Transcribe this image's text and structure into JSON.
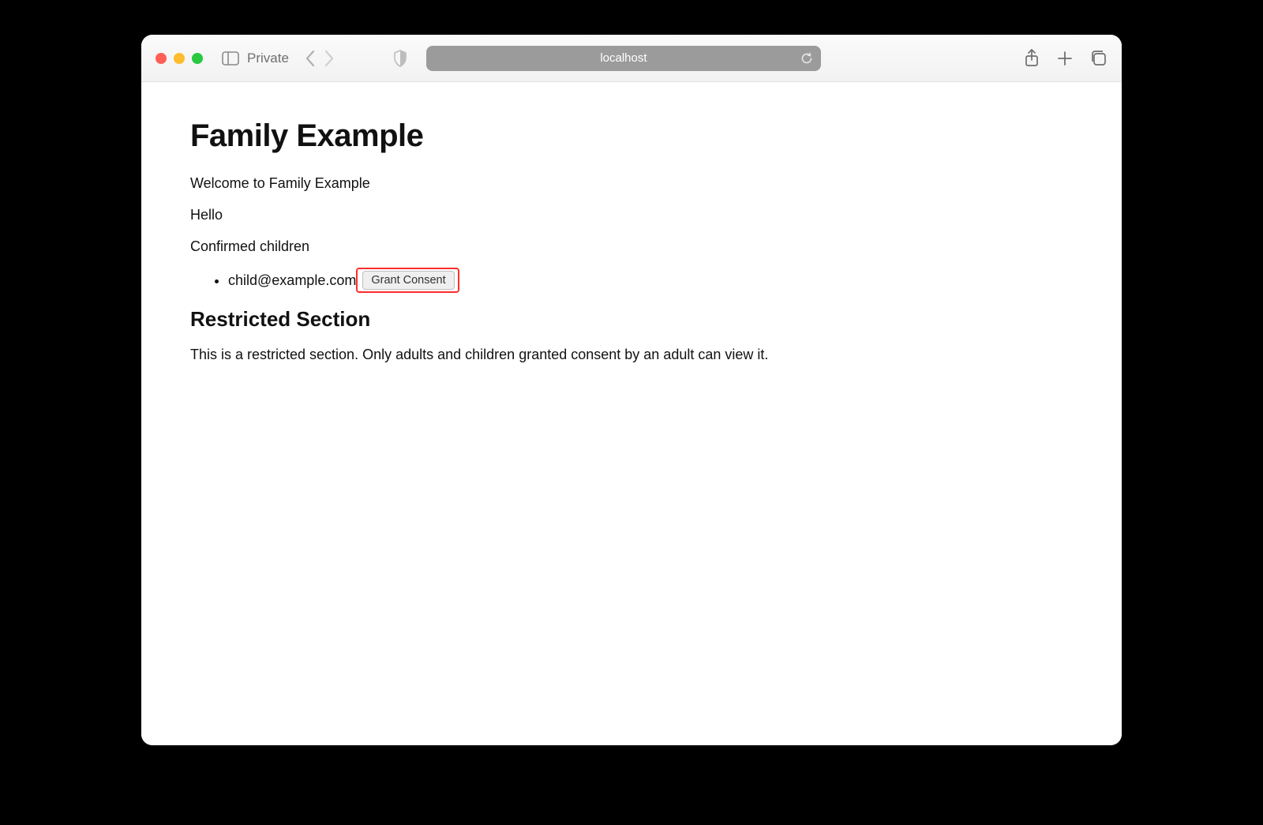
{
  "browser": {
    "mode_label": "Private",
    "address": "localhost"
  },
  "page": {
    "title": "Family Example",
    "welcome": "Welcome to Family Example",
    "greeting": "Hello",
    "confirmed_label": "Confirmed children",
    "children": [
      {
        "email": "child@example.com",
        "action_label": "Grant Consent"
      }
    ],
    "restricted_heading": "Restricted Section",
    "restricted_body": "This is a restricted section. Only adults and children granted consent by an adult can view it."
  },
  "highlight": {
    "target": "grant-consent-button",
    "color": "#ff2d2d"
  }
}
